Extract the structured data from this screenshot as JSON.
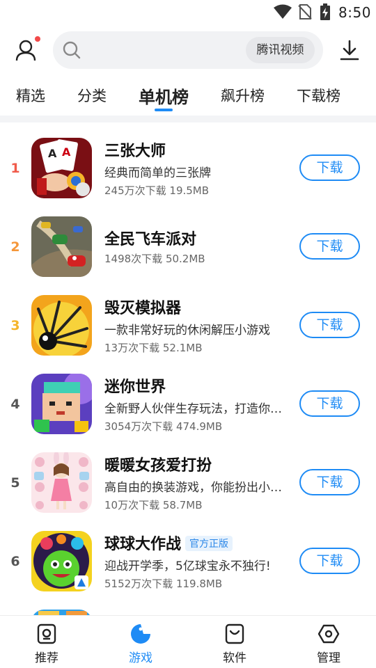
{
  "status_bar": {
    "time": "8:50",
    "icons": [
      "wifi-icon",
      "no-sim-icon",
      "battery-charging-icon"
    ]
  },
  "header": {
    "avatar_icon": "user-icon",
    "search": {
      "placeholder": "",
      "hot_word": "腾讯视频"
    },
    "download_icon": "download-icon"
  },
  "tabs": [
    {
      "label": "精选",
      "active": false
    },
    {
      "label": "分类",
      "active": false
    },
    {
      "label": "单机榜",
      "active": true
    },
    {
      "label": "飙升榜",
      "active": false
    },
    {
      "label": "下载榜",
      "active": false
    }
  ],
  "apps": [
    {
      "rank": "1",
      "name": "三张大师",
      "badge": "",
      "desc": "经典而简单的三张牌",
      "meta": "245万次下载   19.5MB",
      "button": "下载",
      "rank_color": "#f05a4a"
    },
    {
      "rank": "2",
      "name": "全民飞车派对",
      "badge": "",
      "desc": "",
      "meta": "1498次下载   50.2MB",
      "button": "下载",
      "rank_color": "#f5973a"
    },
    {
      "rank": "3",
      "name": "毁灭模拟器",
      "badge": "",
      "desc": "一款非常好玩的休闲解压小游戏",
      "meta": "13万次下载   52.1MB",
      "button": "下载",
      "rank_color": "#f5b42a"
    },
    {
      "rank": "4",
      "name": "迷你世界",
      "badge": "",
      "desc": "全新野人伙伴生存玩法，打造你的专属部落",
      "meta": "3054万次下载   474.9MB",
      "button": "下载",
      "rank_color": "#555555"
    },
    {
      "rank": "5",
      "name": "暖暖女孩爱打扮",
      "badge": "",
      "desc": "高自由的换装游戏，你能扮出小仙女吗",
      "meta": "10万次下载   58.7MB",
      "button": "下载",
      "rank_color": "#555555"
    },
    {
      "rank": "6",
      "name": "球球大作战",
      "badge": "官方正版",
      "desc": "迎战开学季，5亿球宝永不独行!",
      "meta": "5152万次下载   119.8MB",
      "button": "下载",
      "rank_color": "#555555"
    }
  ],
  "bottom_nav": [
    {
      "label": "推荐",
      "icon": "recommend-icon",
      "active": false
    },
    {
      "label": "游戏",
      "icon": "game-icon",
      "active": true
    },
    {
      "label": "软件",
      "icon": "software-icon",
      "active": false
    },
    {
      "label": "管理",
      "icon": "manage-icon",
      "active": false
    }
  ],
  "colors": {
    "accent": "#1e8bf5",
    "notification_dot": "#f24a4a"
  }
}
